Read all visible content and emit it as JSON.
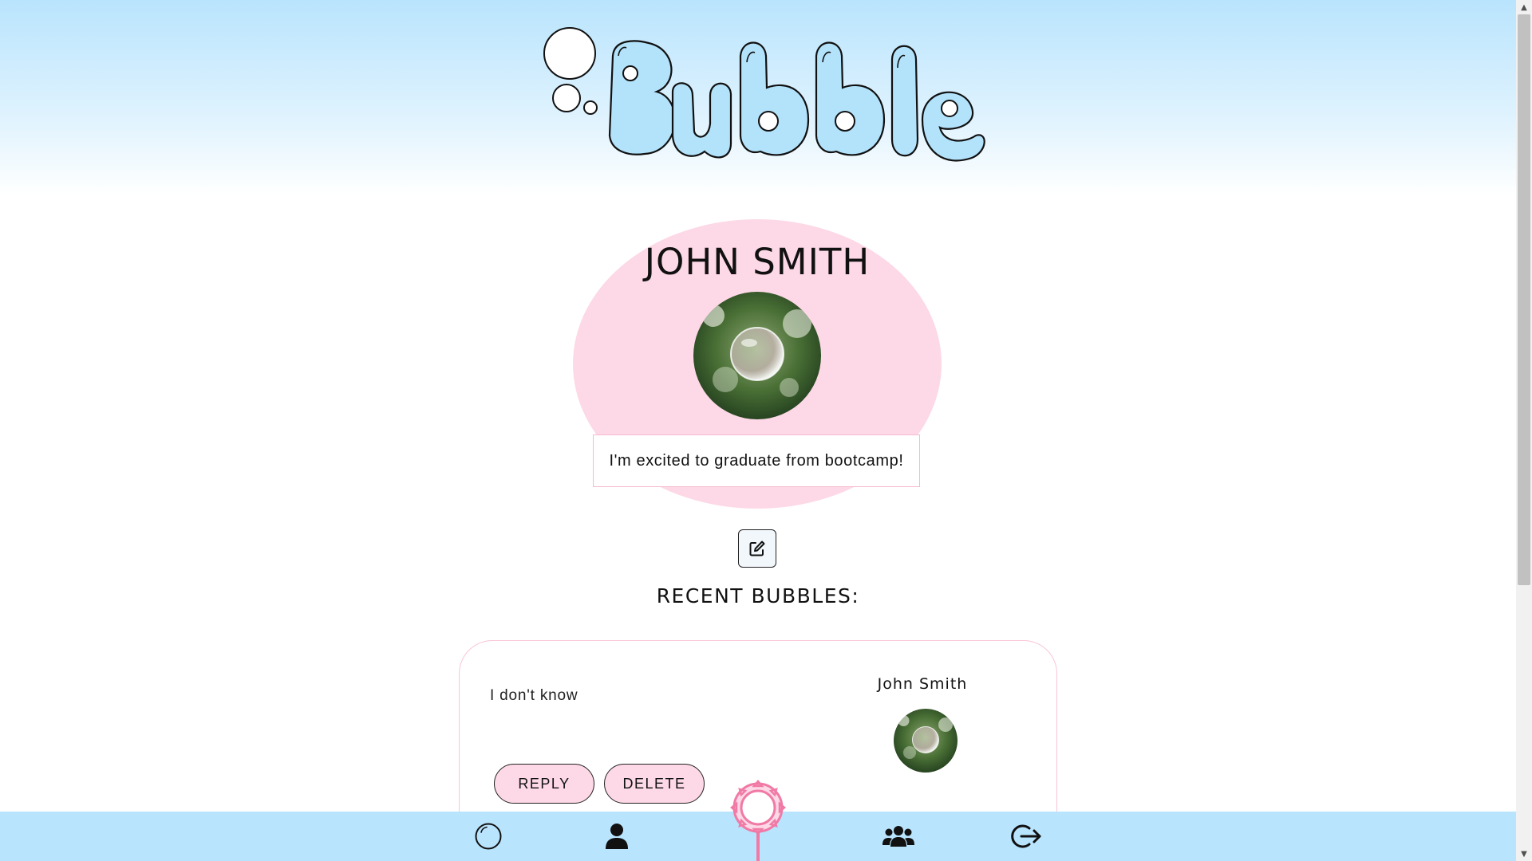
{
  "app": {
    "logo_text": "Bubble"
  },
  "profile": {
    "name": "JOHN SMITH",
    "bio": "I'm excited to graduate from bootcamp!",
    "avatar_icon": "bubble-photo",
    "edit_icon": "edit-icon"
  },
  "recent": {
    "title": "RECENT BUBBLES:",
    "posts": [
      {
        "text": "I don't know",
        "author": "John Smith",
        "reply_label": "REPLY",
        "delete_label": "DELETE"
      }
    ]
  },
  "nav": {
    "items": [
      {
        "icon": "bubble-icon"
      },
      {
        "icon": "user-icon"
      },
      {
        "icon": "bubble-wand-icon"
      },
      {
        "icon": "group-icon"
      },
      {
        "icon": "logout-icon"
      }
    ]
  },
  "colors": {
    "sky": "#b9e4fd",
    "pink": "#fdd8e6",
    "pink_border": "#f6b9cf",
    "logo_fill": "#b3e2fb"
  },
  "scrollbar": {
    "up_arrow": "▲",
    "down_arrow": "▼"
  }
}
